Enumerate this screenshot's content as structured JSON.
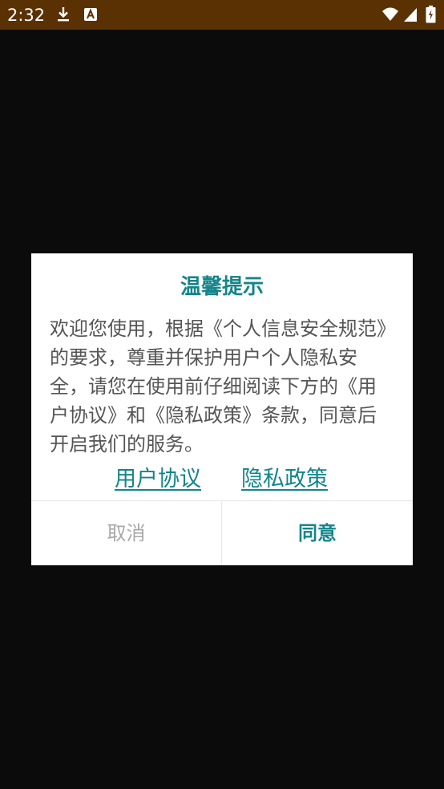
{
  "status_bar": {
    "time": "2:32",
    "icons": [
      "download-icon",
      "a-notification-icon",
      "wifi-icon",
      "signal-icon",
      "battery-icon"
    ],
    "background_color": "#5a3103"
  },
  "dialog": {
    "title": "温馨提示",
    "message": "欢迎您使用，根据《个人信息安全规范》的要求，尊重并保护用户个人隐私安全，请您在使用前仔细阅读下方的《用户协议》和《隐私政策》条款，同意后开启我们的服务。",
    "links": {
      "user_agreement": "用户协议",
      "privacy_policy": "隐私政策"
    },
    "buttons": {
      "cancel": "取消",
      "agree": "同意"
    },
    "accent_color": "#14858a"
  }
}
